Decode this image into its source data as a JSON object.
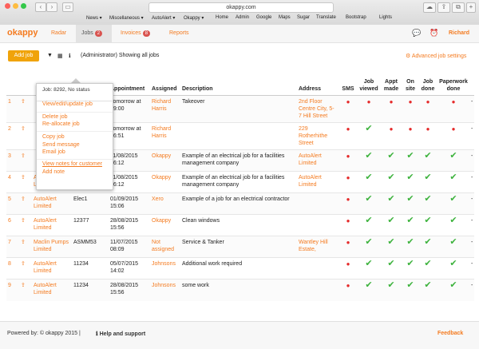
{
  "browser": {
    "url": "okappy.com",
    "bookmarks": [
      "News ▾",
      "Miscellaneous ▾",
      "AutoAlert ▾",
      "Okappy ▾",
      "Home",
      "Admin",
      "Google",
      "Maps",
      "Sugar",
      "Translate",
      "Bootstrap",
      "Lights"
    ],
    "colors": {
      "close": "#fc605b",
      "min": "#fdbc40",
      "max": "#34c84a"
    }
  },
  "app": {
    "logo": "okappy",
    "nav": {
      "radar": "Radar",
      "jobs": "Jobs",
      "jobs_count": "2",
      "invoices": "Invoices",
      "invoices_count": "8",
      "reports": "Reports"
    },
    "user": "Richard",
    "accent": "#f47b20"
  },
  "toolbar": {
    "add_job": "Add job",
    "filter_text": "(Administrator) Showing all jobs",
    "advanced": "Advanced job settings"
  },
  "table": {
    "headers": {
      "num": "",
      "icon": "",
      "company": "",
      "ref": "",
      "appointment": "Appointment",
      "assigned": "Assigned",
      "description": "Description",
      "address": "Address",
      "sms": "SMS",
      "viewed": "Job viewed",
      "appt": "Appt made",
      "onsite": "On site",
      "done": "Job done",
      "paperwork": "Paperwork done"
    },
    "rows": [
      {
        "num": "1",
        "company": "",
        "ref": "",
        "appointment": "Tomorrow at 19:00",
        "assigned": "Richard Harris",
        "description": "Takeover",
        "address": "2nd Floor Centre City, 5-7 Hill Street",
        "sms": "red",
        "viewed": "red",
        "appt": "red",
        "onsite": "red",
        "done": "red",
        "paperwork": "red",
        "last": "-"
      },
      {
        "num": "2",
        "company": "",
        "ref": "",
        "appointment": "Tomorrow at 16:51",
        "assigned": "Richard Harris",
        "description": "",
        "address": "229 Rotherhithe Street",
        "sms": "red",
        "viewed": "check",
        "appt": "red",
        "onsite": "red",
        "done": "red",
        "paperwork": "red",
        "last": "-"
      },
      {
        "num": "3",
        "company": "",
        "ref": "",
        "appointment": "11/08/2015 16:12",
        "assigned": "Okappy",
        "description": "Example of an electrical job for a facilities management company",
        "address": "AutoAlert Limited",
        "sms": "red",
        "viewed": "check",
        "appt": "check",
        "onsite": "check",
        "done": "check",
        "paperwork": "check",
        "last": "-"
      },
      {
        "num": "4",
        "company": "AutoAlert Limited",
        "ref": "",
        "appointment": "11/08/2015 16:12",
        "assigned": "Okappy",
        "description": "Example of an electrical job for a facilities management company",
        "address": "AutoAlert Limited",
        "sms": "red",
        "viewed": "check",
        "appt": "check",
        "onsite": "check",
        "done": "check",
        "paperwork": "check",
        "last": "-"
      },
      {
        "num": "5",
        "company": "AutoAlert Limited",
        "ref": "Elec1",
        "appointment": "01/09/2015 15:06",
        "assigned": "Xero",
        "description": "Example of a job for an electrical contractor",
        "address": "",
        "sms": "red",
        "viewed": "check",
        "appt": "check",
        "onsite": "check",
        "done": "check",
        "paperwork": "check",
        "last": "-"
      },
      {
        "num": "6",
        "company": "AutoAlert Limited",
        "ref": "12377",
        "appointment": "28/08/2015 15:56",
        "assigned": "Okappy",
        "description": "Clean windows",
        "address": "",
        "sms": "red",
        "viewed": "check",
        "appt": "check",
        "onsite": "check",
        "done": "check",
        "paperwork": "check",
        "last": "-"
      },
      {
        "num": "7",
        "company": "Maclin Pumps Limited",
        "ref": "ASMM53",
        "appointment": "11/07/2015 08:09",
        "assigned": "Not assigned",
        "description": "Service & Tanker",
        "address": "Wantley Hill Estate,",
        "sms": "red",
        "viewed": "check",
        "appt": "check",
        "onsite": "check",
        "done": "check",
        "paperwork": "check",
        "last": "-"
      },
      {
        "num": "8",
        "company": "AutoAlert Limited",
        "ref": "11234",
        "appointment": "05/07/2015 14:02",
        "assigned": "Johnsons",
        "description": "Additional work required",
        "address": "",
        "sms": "red",
        "viewed": "check",
        "appt": "check",
        "onsite": "check",
        "done": "check",
        "paperwork": "check",
        "last": "-"
      },
      {
        "num": "9",
        "company": "AutoAlert Limited",
        "ref": "11234",
        "appointment": "28/08/2015 15:56",
        "assigned": "Johnsons",
        "description": "some work",
        "address": "",
        "sms": "red",
        "viewed": "check",
        "appt": "check",
        "onsite": "check",
        "done": "check",
        "paperwork": "check",
        "last": "-"
      }
    ]
  },
  "popup": {
    "header": "Job: 8292, No status",
    "items": [
      "View/edit/update job",
      "Delete job",
      "Re-allocate job",
      "Copy job",
      "Send message",
      "Email job",
      "View notes for customer",
      "Add note"
    ]
  },
  "footer": {
    "powered": "Powered by: © okappy 2015 |",
    "help": "Help and support",
    "feedback": "Feedback"
  }
}
